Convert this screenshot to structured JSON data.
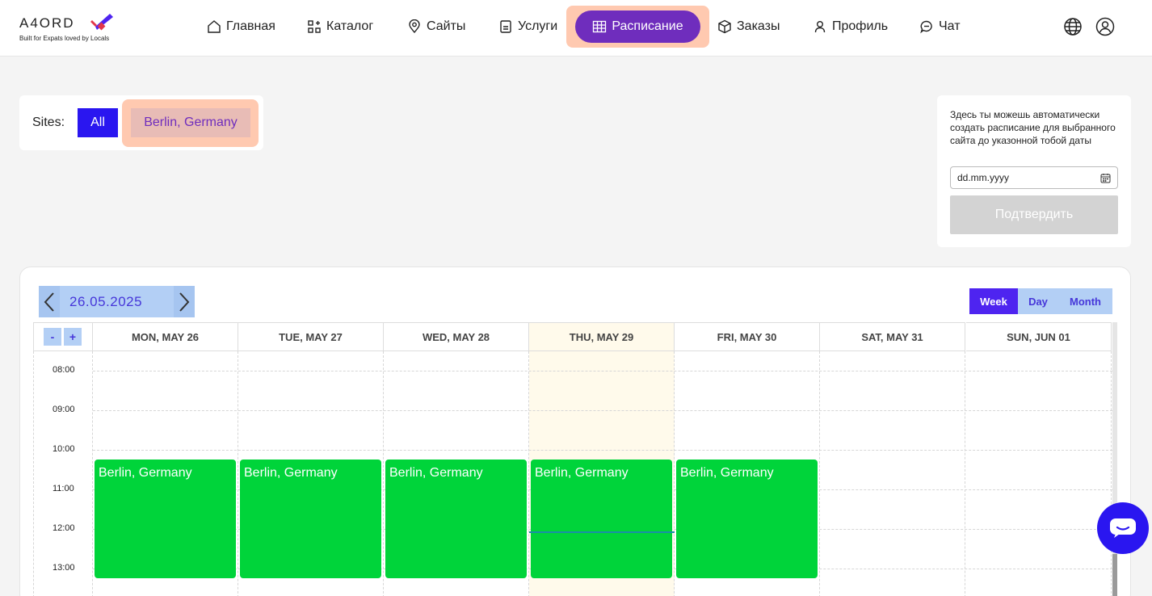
{
  "brand": {
    "name": "A4ORD",
    "tagline": "Built for Expats loved by Locals",
    "colors": {
      "accent": "#6f2dbd",
      "primary": "#2a16f0",
      "event": "#00d43a"
    }
  },
  "nav": {
    "items": [
      {
        "label": "Главная",
        "icon": "home-icon"
      },
      {
        "label": "Каталог",
        "icon": "catalog-icon"
      },
      {
        "label": "Сайты",
        "icon": "location-pin-icon"
      },
      {
        "label": "Услуги",
        "icon": "services-icon"
      },
      {
        "label": "Расписание",
        "icon": "schedule-grid-icon",
        "active": true
      },
      {
        "label": "Заказы",
        "icon": "box-icon"
      },
      {
        "label": "Профиль",
        "icon": "user-icon"
      },
      {
        "label": "Чат",
        "icon": "chat-bubble-icon"
      }
    ],
    "right_icons": [
      "globe-icon",
      "account-circle-icon"
    ]
  },
  "sites": {
    "label": "Sites:",
    "options": [
      "All",
      "Berlin, Germany"
    ],
    "selected": "All"
  },
  "auto_schedule": {
    "description": "Здесь ты можешь автоматически создать расписание для выбранного сайта до указонной тобой даты",
    "date_placeholder": "dd.mm.yyyy",
    "confirm_label": "Подтвердить"
  },
  "calendar": {
    "current_date": "26.05.2025",
    "views": [
      "Week",
      "Day",
      "Month"
    ],
    "active_view": "Week",
    "zoom_out": "-",
    "zoom_in": "+",
    "days": [
      "MON, MAY 26",
      "TUE, MAY 27",
      "WED, MAY 28",
      "THU, MAY 29",
      "FRI, MAY 30",
      "SAT, MAY 31",
      "SUN, JUN 01"
    ],
    "today_index": 3,
    "times": [
      "08:00",
      "09:00",
      "10:00",
      "11:00",
      "12:00",
      "13:00"
    ],
    "events": [
      {
        "day": 0,
        "title": "Berlin, Germany",
        "start": "10:15",
        "end": "13:15"
      },
      {
        "day": 1,
        "title": "Berlin, Germany",
        "start": "10:15",
        "end": "13:15"
      },
      {
        "day": 2,
        "title": "Berlin, Germany",
        "start": "10:15",
        "end": "13:15"
      },
      {
        "day": 3,
        "title": "Berlin, Germany",
        "start": "10:15",
        "end": "13:15"
      },
      {
        "day": 4,
        "title": "Berlin, Germany",
        "start": "10:15",
        "end": "13:15"
      }
    ]
  }
}
